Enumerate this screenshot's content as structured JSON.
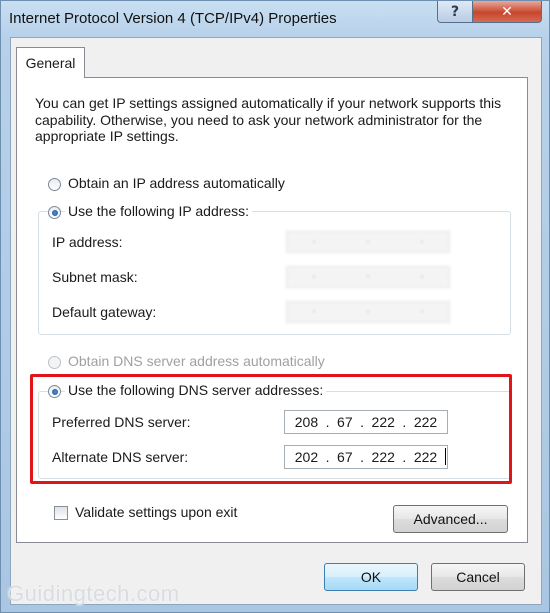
{
  "window": {
    "title": "Internet Protocol Version 4 (TCP/IPv4) Properties",
    "help_label": "?",
    "close_label": "✕"
  },
  "tabs": [
    {
      "label": "General",
      "selected": true
    }
  ],
  "intro_text": "You can get IP settings assigned automatically if your network supports this capability. Otherwise, you need to ask your network administrator for the appropriate IP settings.",
  "ip_section": {
    "auto_label": "Obtain an IP address automatically",
    "auto_selected": false,
    "manual_label": "Use the following IP address:",
    "manual_selected": true,
    "fields": [
      {
        "label": "IP address:",
        "value": "obscured"
      },
      {
        "label": "Subnet mask:",
        "value": "obscured"
      },
      {
        "label": "Default gateway:",
        "value": "obscured"
      }
    ]
  },
  "dns_section": {
    "auto_label": "Obtain DNS server address automatically",
    "auto_enabled": false,
    "manual_label": "Use the following DNS server addresses:",
    "manual_selected": true,
    "preferred": {
      "label": "Preferred DNS server:",
      "octets": [
        "208",
        "67",
        "222",
        "222"
      ]
    },
    "alternate": {
      "label": "Alternate DNS server:",
      "octets": [
        "202",
        "67",
        "222",
        "222"
      ]
    }
  },
  "validate": {
    "label": "Validate settings upon exit",
    "checked": false
  },
  "buttons": {
    "advanced": "Advanced...",
    "ok": "OK",
    "cancel": "Cancel"
  },
  "watermark": "Guidingtech.com",
  "colors": {
    "highlight": "#e1141a",
    "close_button": "#c7462d",
    "title_bar": "#b7d1ea"
  }
}
